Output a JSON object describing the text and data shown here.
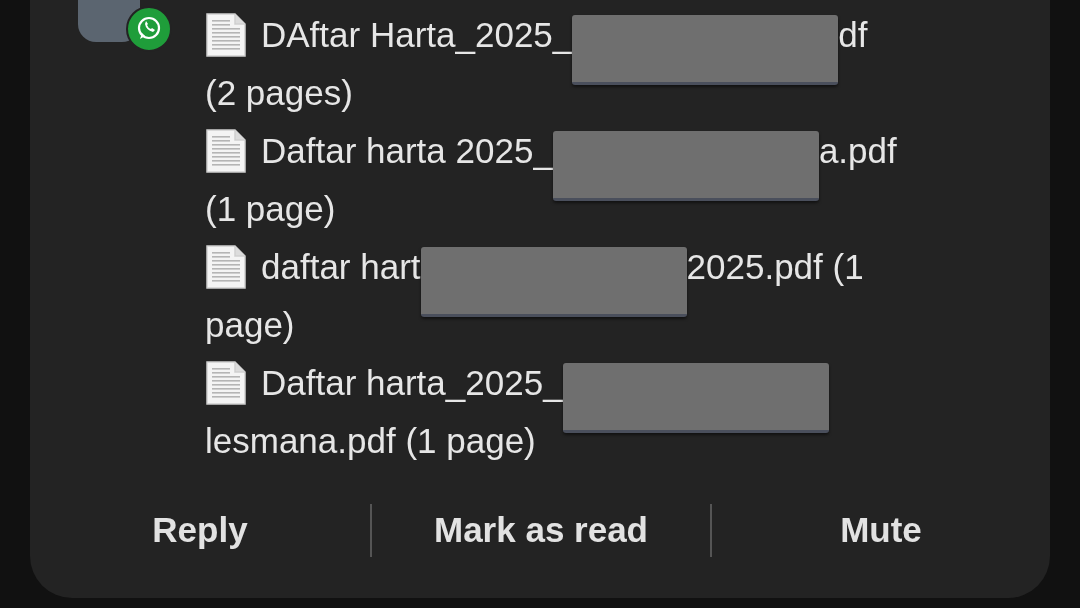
{
  "files": [
    {
      "line_1": {
        "before": "DAftar Harta_2025_",
        "after": "df"
      },
      "line_2": "(2 pages)"
    },
    {
      "line_1": {
        "before": "Daftar harta 2025_",
        "after": "a.pdf"
      },
      "line_2": "(1 page)"
    },
    {
      "line_1": {
        "before": "daftar hart",
        "after": "2025.pdf (1"
      },
      "line_2": "page)"
    },
    {
      "line_1": {
        "before": "Daftar harta_2025_"
      },
      "line_2": "lesmana.pdf (1 page)"
    }
  ],
  "actions": [
    "Reply",
    "Mark as read",
    "Mute"
  ]
}
